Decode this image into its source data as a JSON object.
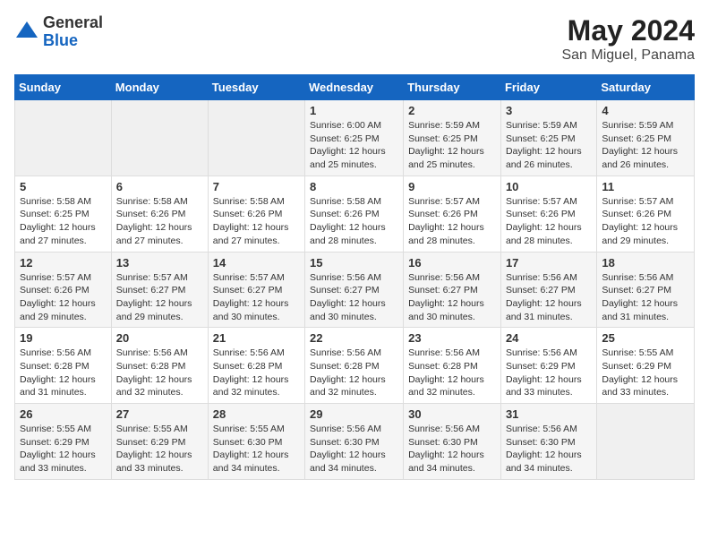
{
  "logo": {
    "general": "General",
    "blue": "Blue"
  },
  "title": "May 2024",
  "location": "San Miguel, Panama",
  "weekdays": [
    "Sunday",
    "Monday",
    "Tuesday",
    "Wednesday",
    "Thursday",
    "Friday",
    "Saturday"
  ],
  "weeks": [
    [
      {
        "day": "",
        "info": ""
      },
      {
        "day": "",
        "info": ""
      },
      {
        "day": "",
        "info": ""
      },
      {
        "day": "1",
        "info": "Sunrise: 6:00 AM\nSunset: 6:25 PM\nDaylight: 12 hours\nand 25 minutes."
      },
      {
        "day": "2",
        "info": "Sunrise: 5:59 AM\nSunset: 6:25 PM\nDaylight: 12 hours\nand 25 minutes."
      },
      {
        "day": "3",
        "info": "Sunrise: 5:59 AM\nSunset: 6:25 PM\nDaylight: 12 hours\nand 26 minutes."
      },
      {
        "day": "4",
        "info": "Sunrise: 5:59 AM\nSunset: 6:25 PM\nDaylight: 12 hours\nand 26 minutes."
      }
    ],
    [
      {
        "day": "5",
        "info": "Sunrise: 5:58 AM\nSunset: 6:25 PM\nDaylight: 12 hours\nand 27 minutes."
      },
      {
        "day": "6",
        "info": "Sunrise: 5:58 AM\nSunset: 6:26 PM\nDaylight: 12 hours\nand 27 minutes."
      },
      {
        "day": "7",
        "info": "Sunrise: 5:58 AM\nSunset: 6:26 PM\nDaylight: 12 hours\nand 27 minutes."
      },
      {
        "day": "8",
        "info": "Sunrise: 5:58 AM\nSunset: 6:26 PM\nDaylight: 12 hours\nand 28 minutes."
      },
      {
        "day": "9",
        "info": "Sunrise: 5:57 AM\nSunset: 6:26 PM\nDaylight: 12 hours\nand 28 minutes."
      },
      {
        "day": "10",
        "info": "Sunrise: 5:57 AM\nSunset: 6:26 PM\nDaylight: 12 hours\nand 28 minutes."
      },
      {
        "day": "11",
        "info": "Sunrise: 5:57 AM\nSunset: 6:26 PM\nDaylight: 12 hours\nand 29 minutes."
      }
    ],
    [
      {
        "day": "12",
        "info": "Sunrise: 5:57 AM\nSunset: 6:26 PM\nDaylight: 12 hours\nand 29 minutes."
      },
      {
        "day": "13",
        "info": "Sunrise: 5:57 AM\nSunset: 6:27 PM\nDaylight: 12 hours\nand 29 minutes."
      },
      {
        "day": "14",
        "info": "Sunrise: 5:57 AM\nSunset: 6:27 PM\nDaylight: 12 hours\nand 30 minutes."
      },
      {
        "day": "15",
        "info": "Sunrise: 5:56 AM\nSunset: 6:27 PM\nDaylight: 12 hours\nand 30 minutes."
      },
      {
        "day": "16",
        "info": "Sunrise: 5:56 AM\nSunset: 6:27 PM\nDaylight: 12 hours\nand 30 minutes."
      },
      {
        "day": "17",
        "info": "Sunrise: 5:56 AM\nSunset: 6:27 PM\nDaylight: 12 hours\nand 31 minutes."
      },
      {
        "day": "18",
        "info": "Sunrise: 5:56 AM\nSunset: 6:27 PM\nDaylight: 12 hours\nand 31 minutes."
      }
    ],
    [
      {
        "day": "19",
        "info": "Sunrise: 5:56 AM\nSunset: 6:28 PM\nDaylight: 12 hours\nand 31 minutes."
      },
      {
        "day": "20",
        "info": "Sunrise: 5:56 AM\nSunset: 6:28 PM\nDaylight: 12 hours\nand 32 minutes."
      },
      {
        "day": "21",
        "info": "Sunrise: 5:56 AM\nSunset: 6:28 PM\nDaylight: 12 hours\nand 32 minutes."
      },
      {
        "day": "22",
        "info": "Sunrise: 5:56 AM\nSunset: 6:28 PM\nDaylight: 12 hours\nand 32 minutes."
      },
      {
        "day": "23",
        "info": "Sunrise: 5:56 AM\nSunset: 6:28 PM\nDaylight: 12 hours\nand 32 minutes."
      },
      {
        "day": "24",
        "info": "Sunrise: 5:56 AM\nSunset: 6:29 PM\nDaylight: 12 hours\nand 33 minutes."
      },
      {
        "day": "25",
        "info": "Sunrise: 5:55 AM\nSunset: 6:29 PM\nDaylight: 12 hours\nand 33 minutes."
      }
    ],
    [
      {
        "day": "26",
        "info": "Sunrise: 5:55 AM\nSunset: 6:29 PM\nDaylight: 12 hours\nand 33 minutes."
      },
      {
        "day": "27",
        "info": "Sunrise: 5:55 AM\nSunset: 6:29 PM\nDaylight: 12 hours\nand 33 minutes."
      },
      {
        "day": "28",
        "info": "Sunrise: 5:55 AM\nSunset: 6:30 PM\nDaylight: 12 hours\nand 34 minutes."
      },
      {
        "day": "29",
        "info": "Sunrise: 5:56 AM\nSunset: 6:30 PM\nDaylight: 12 hours\nand 34 minutes."
      },
      {
        "day": "30",
        "info": "Sunrise: 5:56 AM\nSunset: 6:30 PM\nDaylight: 12 hours\nand 34 minutes."
      },
      {
        "day": "31",
        "info": "Sunrise: 5:56 AM\nSunset: 6:30 PM\nDaylight: 12 hours\nand 34 minutes."
      },
      {
        "day": "",
        "info": ""
      }
    ]
  ]
}
